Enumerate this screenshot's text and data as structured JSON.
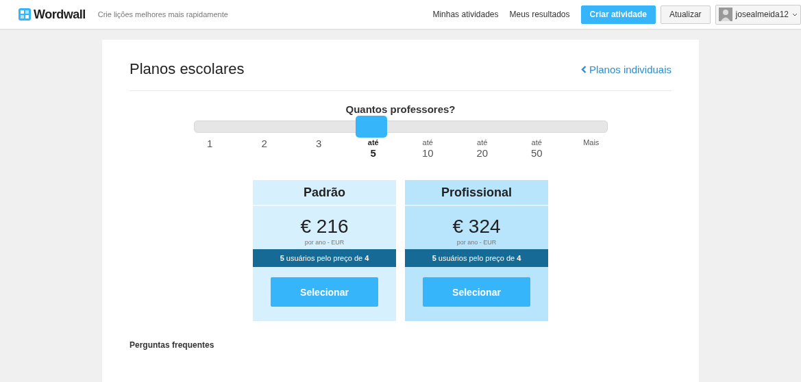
{
  "header": {
    "logo": "Wordwall",
    "tagline": "Crie lições melhores mais rapidamente",
    "nav": [
      {
        "label": "Minhas atividades",
        "kind": "link"
      },
      {
        "label": "Meus resultados",
        "kind": "link"
      },
      {
        "label": "Criar atividade",
        "kind": "primary"
      },
      {
        "label": "Atualizar",
        "kind": "outline"
      }
    ],
    "user": "josealmeida12"
  },
  "page": {
    "title": "Planos escolares",
    "back_link": "Planos individuais"
  },
  "slider": {
    "question": "Quantos professores?",
    "level": 0.43,
    "stops": [
      {
        "value": "1",
        "selected": false
      },
      {
        "value": "2",
        "selected": false
      },
      {
        "value": "3",
        "selected": false
      },
      {
        "prefix": "até",
        "value": "5",
        "selected": true
      },
      {
        "prefix": "até",
        "value": "10",
        "selected": false
      },
      {
        "prefix": "até",
        "value": "20",
        "selected": false
      },
      {
        "prefix": "até",
        "value": "50",
        "selected": false
      },
      {
        "prefix": "Mais",
        "selected": false
      }
    ]
  },
  "plans": [
    {
      "name": "Padrão",
      "price": "€ 216",
      "period": "por ano - EUR",
      "offer": "**5** usuários pelo preço de **4**",
      "button": "Selecionar",
      "highlighted": false
    },
    {
      "name": "Profissional",
      "price": "€ 324",
      "period": "por ano - EUR",
      "offer": "**5** usuários pelo preço de **4**",
      "button": "Selecionar",
      "highlighted": true
    }
  ],
  "faq_title": "Perguntas frequentes"
}
